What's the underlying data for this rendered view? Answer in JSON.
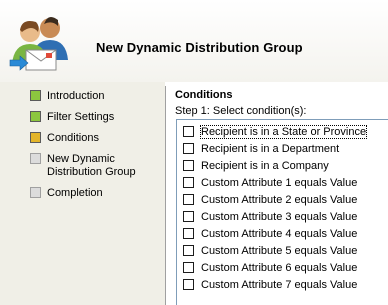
{
  "window": {
    "title": "New Dynamic Distribution Group"
  },
  "icon": {
    "name": "distribution-group-users-icon"
  },
  "steps": [
    {
      "label": "Introduction",
      "state": "completed",
      "color": "#8cc63f"
    },
    {
      "label": "Filter Settings",
      "state": "completed",
      "color": "#8cc63f"
    },
    {
      "label": "Conditions",
      "state": "current",
      "color": "#e3b52a"
    },
    {
      "label": "New Dynamic\nDistribution Group",
      "state": "pending",
      "color": "#dcdcdc"
    },
    {
      "label": "Completion",
      "state": "pending",
      "color": "#dcdcdc"
    }
  ],
  "conditions": {
    "title": "Conditions",
    "step_label": "Step 1: Select condition(s):",
    "items": [
      {
        "label": "Recipient is in a State or Province",
        "checked": false,
        "focused": true
      },
      {
        "label": "Recipient is in a Department",
        "checked": false
      },
      {
        "label": "Recipient is in a Company",
        "checked": false
      },
      {
        "label": "Custom Attribute 1 equals Value",
        "checked": false
      },
      {
        "label": "Custom Attribute 2 equals Value",
        "checked": false
      },
      {
        "label": "Custom Attribute 3 equals Value",
        "checked": false
      },
      {
        "label": "Custom Attribute 4 equals Value",
        "checked": false
      },
      {
        "label": "Custom Attribute 5 equals Value",
        "checked": false
      },
      {
        "label": "Custom Attribute 6 equals Value",
        "checked": false
      },
      {
        "label": "Custom Attribute 7 equals Value",
        "checked": false
      }
    ]
  }
}
